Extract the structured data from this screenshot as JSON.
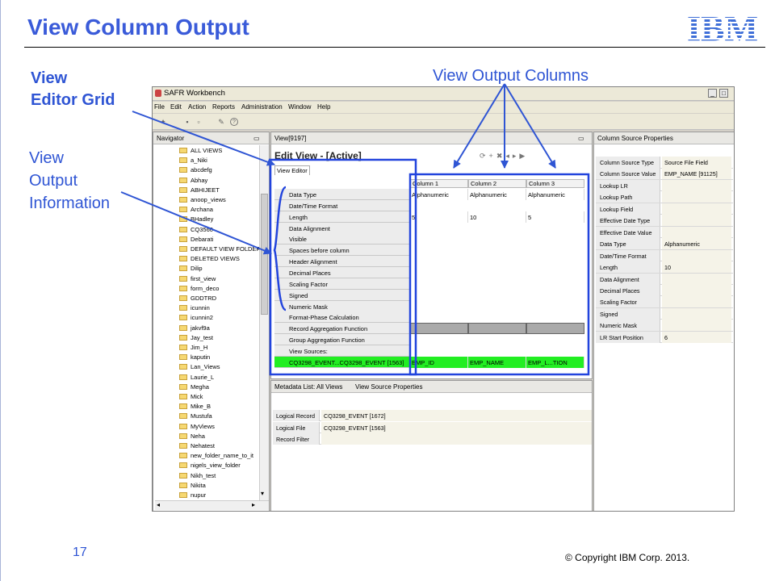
{
  "slide": {
    "title": "View Column Output",
    "logo_text": "IBM",
    "page_number": "17",
    "copyright": "© Copyright IBM Corp. 2013.",
    "accent_color": "#3a5bd9"
  },
  "annotations": {
    "editor_grid": [
      "View",
      "Editor Grid"
    ],
    "output_info": [
      "View",
      "Output",
      "Information"
    ],
    "output_columns": "View Output Columns"
  },
  "app": {
    "window_title": "SAFR Workbench",
    "menu": [
      "File",
      "Edit",
      "Action",
      "Reports",
      "Administration",
      "Window",
      "Help"
    ],
    "toolbar_icons": [
      "new-icon",
      "save-icon",
      "print-icon",
      "edit-icon",
      "help-icon"
    ],
    "navigator": {
      "tab_label": "Navigator",
      "items": [
        "ALL VIEWS",
        "a_Niki",
        "abcdefg",
        "Abhay",
        "ABHIJEET",
        "anoop_views",
        "Archana",
        "BHadley",
        "CQ3560",
        "Debarati",
        "DEFAULT VIEW FOLDER",
        "DELETED VIEWS",
        "Dilip",
        "first_view",
        "form_deco",
        "GDDTRD",
        "icunnin",
        "icunnin2",
        "jakvf9a",
        "Jay_test",
        "Jim_H",
        "kaputin",
        "Lan_Views",
        "Laurie_L",
        "Megha",
        "Mick",
        "Mike_B",
        "Mustufa",
        "MyViews",
        "Neha",
        "Nehatest",
        "new_folder_name_to_it",
        "nigels_view_folder",
        "Nikh_test",
        "Nikita",
        "nupur"
      ]
    },
    "view_editor": {
      "tab_label": "View[9197]",
      "heading": "Edit View - [Active]",
      "sub_tab": "View Editor",
      "row_labels": [
        "Data Type",
        "Date/Time Format",
        "Length",
        "Data Alignment",
        "Visible",
        "Spaces before column",
        "Header Alignment",
        "Decimal Places",
        "Scaling Factor",
        "Signed",
        "Numeric Mask",
        "Format-Phase Calculation",
        "Record Aggregation Function",
        "Group Aggregation Function",
        "View Sources:"
      ],
      "source_row": "CQ3298_EVENT...CQ3298_EVENT [1563]",
      "columns": [
        {
          "header": "Column 1",
          "data_type": "Alphanumeric",
          "length": "5",
          "source": "EMP_ID"
        },
        {
          "header": "Column 2",
          "data_type": "Alphanumeric",
          "length": "10",
          "source": "EMP_NAME"
        },
        {
          "header": "Column 3",
          "data_type": "Alphanumeric",
          "length": "5",
          "source": "EMP_L...TION"
        }
      ]
    },
    "bottom": {
      "tab1": "Metadata List: All Views",
      "tab2": "View Source Properties",
      "rows": [
        {
          "label": "Logical Record",
          "value": "CQ3298_EVENT [1672]"
        },
        {
          "label": "Logical File",
          "value": "CQ3298_EVENT [1563]"
        },
        {
          "label": "Record Filter",
          "value": ""
        }
      ]
    },
    "column_source": {
      "tab_label": "Column Source Properties",
      "rows": [
        {
          "label": "Column Source Type",
          "value": "Source File Field"
        },
        {
          "label": "Column Source Value",
          "value": "EMP_NAME [91125]"
        },
        {
          "label": "Lookup LR",
          "value": ""
        },
        {
          "label": "Lookup Path",
          "value": ""
        },
        {
          "label": "Lookup Field",
          "value": ""
        },
        {
          "label": "Effective Date Type",
          "value": ""
        },
        {
          "label": "Effective Date Value",
          "value": ""
        },
        {
          "label": "Data Type",
          "value": "Alphanumeric"
        },
        {
          "label": "Date/Time Format",
          "value": ""
        },
        {
          "label": "Length",
          "value": "10"
        },
        {
          "label": "Data Alignment",
          "value": ""
        },
        {
          "label": "Decimal Places",
          "value": ""
        },
        {
          "label": "Scaling Factor",
          "value": ""
        },
        {
          "label": "Signed",
          "value": ""
        },
        {
          "label": "Numeric Mask",
          "value": ""
        },
        {
          "label": "LR Start Position",
          "value": "6"
        }
      ]
    },
    "colors": {
      "highlight_blue": "#2244dd",
      "source_green": "#22ee22"
    }
  }
}
